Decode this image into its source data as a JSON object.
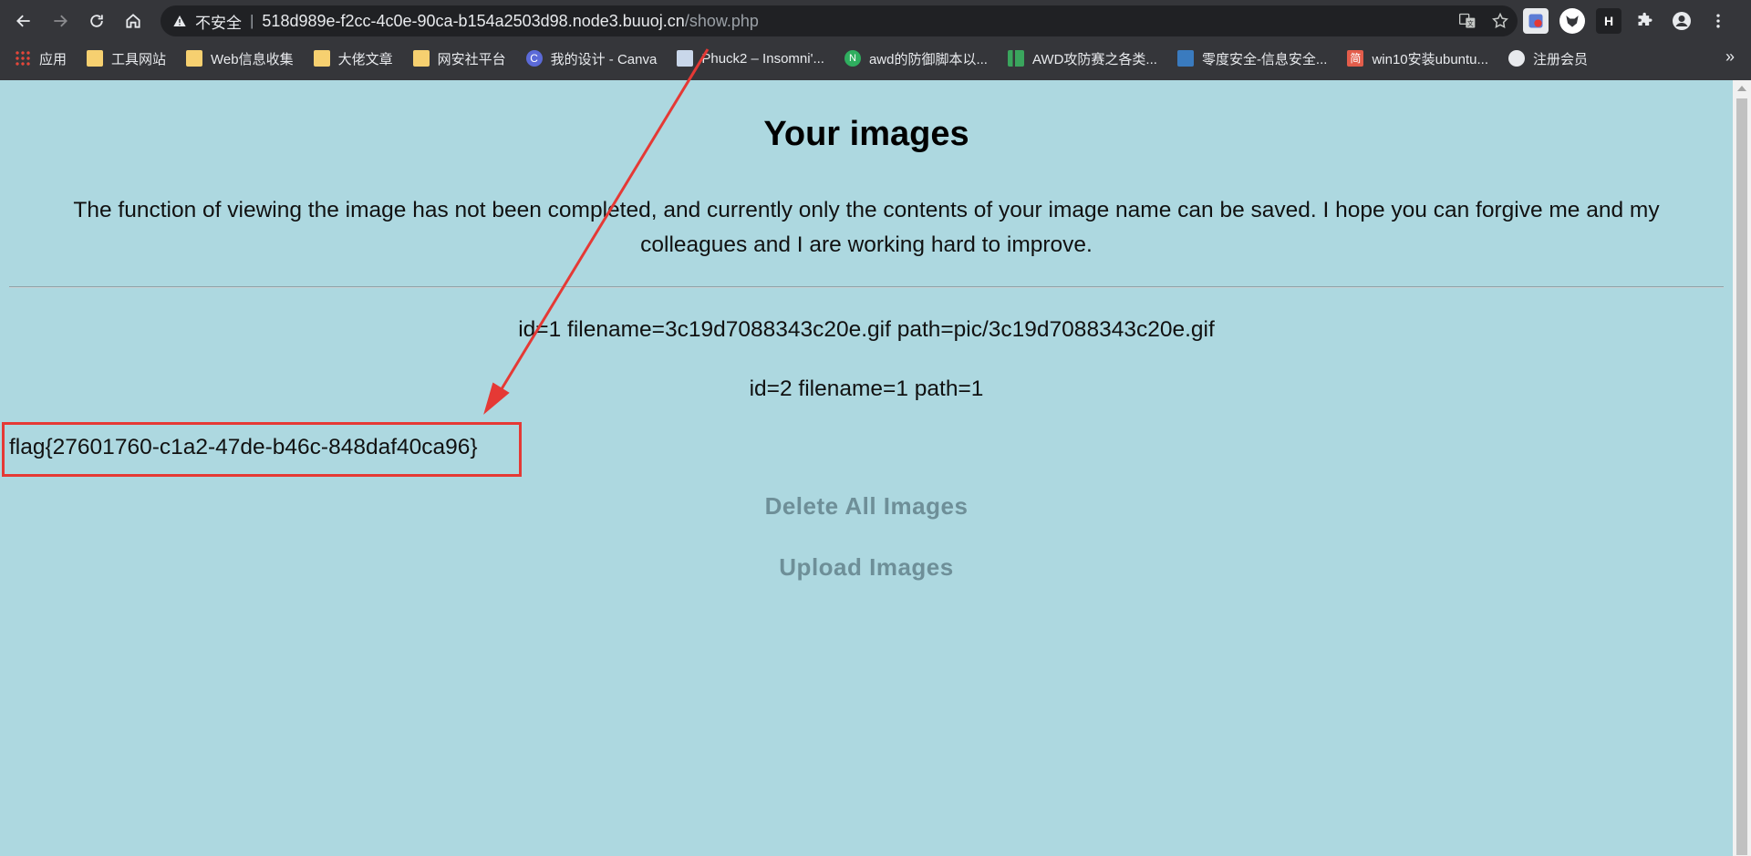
{
  "browser": {
    "security_label": "不安全",
    "url_host": "518d989e-f2cc-4c0e-90ca-b154a2503d98.node3.buuoj.cn",
    "url_path": "/show.php"
  },
  "bookmarks": [
    {
      "label": "应用",
      "icon": "apps-icon"
    },
    {
      "label": "工具网站",
      "icon": "folder-icon"
    },
    {
      "label": "Web信息收集",
      "icon": "folder-icon"
    },
    {
      "label": "大佬文章",
      "icon": "folder-icon"
    },
    {
      "label": "网安社平台",
      "icon": "folder-icon"
    },
    {
      "label": "我的设计 - Canva",
      "icon": "canva-icon"
    },
    {
      "label": "Phuck2 – Insomni'...",
      "icon": "page-icon"
    },
    {
      "label": "awd的防御脚本以...",
      "icon": "globe-icon"
    },
    {
      "label": "AWD攻防赛之各类...",
      "icon": "chart-icon"
    },
    {
      "label": "零度安全-信息安全...",
      "icon": "shield-icon"
    },
    {
      "label": "win10安装ubuntu...",
      "icon": "jianshu-icon"
    },
    {
      "label": "注册会员",
      "icon": "globe-icon"
    }
  ],
  "page": {
    "title": "Your images",
    "description": "The function of viewing the image has not been completed, and currently only the contents of your image name can be saved. I hope you can forgive me and my colleagues and I are working hard to improve.",
    "rows": [
      "id=1 filename=3c19d7088343c20e.gif path=pic/3c19d7088343c20e.gif",
      "id=2 filename=1 path=1"
    ],
    "flag": "flag{27601760-c1a2-47de-b46c-848daf40ca96}",
    "delete_label": "Delete All Images",
    "upload_label": "Upload Images"
  },
  "colors": {
    "page_bg": "#add8e0",
    "annotation": "#e53935",
    "button_text": "#6e8f98"
  }
}
